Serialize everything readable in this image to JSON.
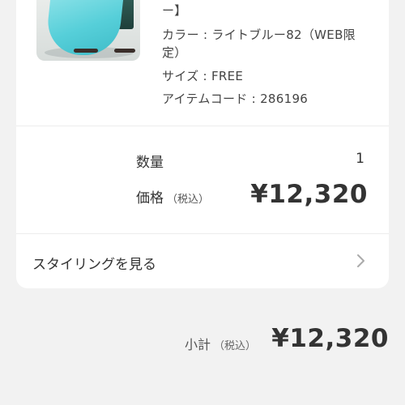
{
  "product": {
    "name_tail": "ー】",
    "color_line_1": "カラー : ライトブルー82（WEB限",
    "color_line_2": "定）",
    "size": "サイズ : FREE",
    "item_code": "アイテムコード : 286196"
  },
  "order": {
    "quantity_label": "数量",
    "quantity_value": "1",
    "price_label": "価格",
    "price_tax_note": "（税込）",
    "price_value": "¥12,320"
  },
  "styling": {
    "label": "スタイリングを見る",
    "icon": "chevron-right-icon"
  },
  "subtotal": {
    "label": "小計",
    "tax_note": "（税込）",
    "value": "¥12,320"
  }
}
